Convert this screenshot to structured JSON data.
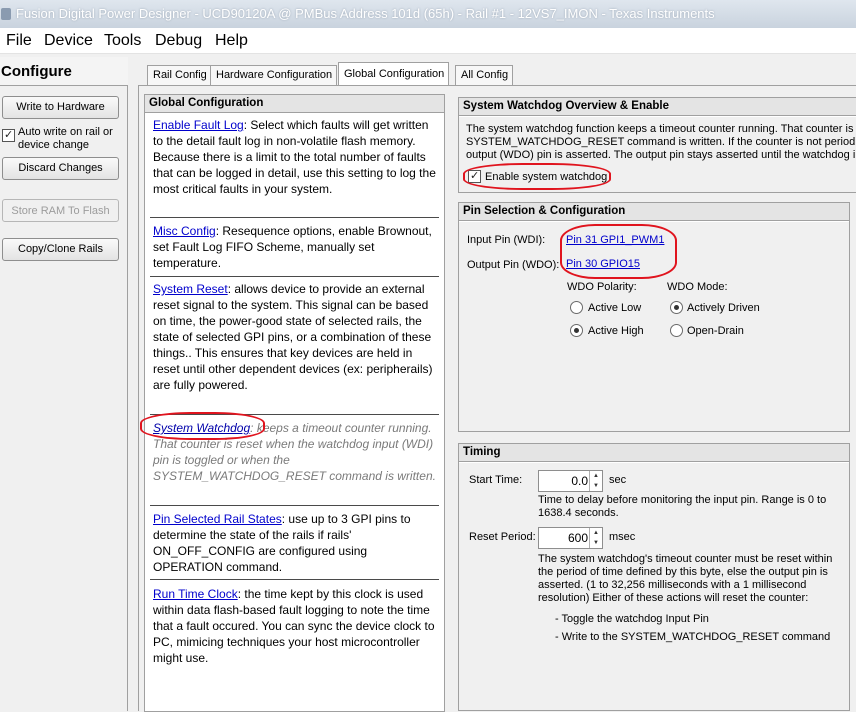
{
  "window": {
    "title": "Fusion Digital Power Designer - UCD90120A @ PMBus Address 101d (65h) - Rail #1 - 12VS7_IMON - Texas Instruments"
  },
  "menu": [
    "File",
    "Device",
    "Tools",
    "Debug",
    "Help"
  ],
  "configure": {
    "title": "Configure",
    "write_to_hardware": "Write to Hardware",
    "auto_write_label": "Auto write on rail or device change",
    "discard_changes": "Discard Changes",
    "store_ram_to_flash": "Store RAM To Flash",
    "copy_clone_rails": "Copy/Clone Rails"
  },
  "tabs": [
    "Rail Config",
    "Hardware Configuration",
    "Global Configuration",
    "All Config"
  ],
  "help": {
    "header": "Global Configuration",
    "items": [
      {
        "link": "Enable Fault Log",
        "text": ": Select which faults will get written to the detail fault log in non-volatile flash memory. Because there is a limit to the total number of faults that can be logged in detail, use this setting to log the most critical faults in your system."
      },
      {
        "link": "Misc Config",
        "text": ": Resequence options, enable Brownout, set Fault Log FIFO Scheme, manually set temperature."
      },
      {
        "link": "System Reset",
        "text": ": allows device to provide an external reset signal to the system. This signal can be based on time, the power-good state of selected rails, the state of selected GPI pins, or a combination of these things.. This ensures that key devices are held in reset until other dependent devices (ex: peripherails) are fully powered."
      },
      {
        "link": "System Watchdog",
        "text": ": keeps a timeout counter running. That counter is reset when the watchdog input (WDI) pin is toggled or when the SYSTEM_WATCHDOG_RESET command is written."
      },
      {
        "link": "Pin Selected Rail States",
        "text": ": use up to 3 GPI pins to determine the state of the rails if rails' ON_OFF_CONFIG are configured using OPERATION command."
      },
      {
        "link": "Run Time Clock",
        "text": ": the time kept by this clock is used within data flash-based fault logging to note the time that a fault occured. You can sync the device clock to PC, mimicing techniques your host microcontroller might use."
      }
    ]
  },
  "watchdog": {
    "header": "System Watchdog Overview & Enable",
    "desc_lines": [
      "The system watchdog function keeps a timeout counter running.  That counter is r",
      "SYSTEM_WATCHDOG_RESET command is written.  If the counter is not periodicall",
      "output (WDO) pin is asserted.  The output pin stays asserted until the watchdog i"
    ],
    "enable_label": "Enable system watchdog"
  },
  "pins": {
    "header": "Pin Selection & Configuration",
    "input_label": "Input Pin (WDI):",
    "input_value": "Pin 31 GPI1_PWM1",
    "output_label": "Output Pin (WDO):",
    "output_value": "Pin 30 GPIO15",
    "polarity_label": "WDO Polarity:",
    "polarity_options": [
      "Active Low",
      "Active High"
    ],
    "mode_label": "WDO Mode:",
    "mode_options": [
      "Actively Driven",
      "Open-Drain"
    ]
  },
  "timing": {
    "header": "Timing",
    "start_label": "Start Time:",
    "start_value": "0.0",
    "start_unit": "sec",
    "start_desc": [
      "Time to delay before monitoring the input pin. Range is 0 to",
      "1638.4 seconds."
    ],
    "reset_label": "Reset Period:",
    "reset_value": "600",
    "reset_unit": "msec",
    "reset_desc": [
      "The system watchdog's timeout counter must be reset within",
      "the period of time defined by this byte, else the output pin is",
      "asserted.  (1 to 32,256 milliseconds with a 1 millisecond",
      "resolution)  Either of these actions will reset the counter:"
    ],
    "actions": [
      "- Toggle the watchdog Input Pin",
      "- Write to the SYSTEM_WATCHDOG_RESET command"
    ]
  }
}
